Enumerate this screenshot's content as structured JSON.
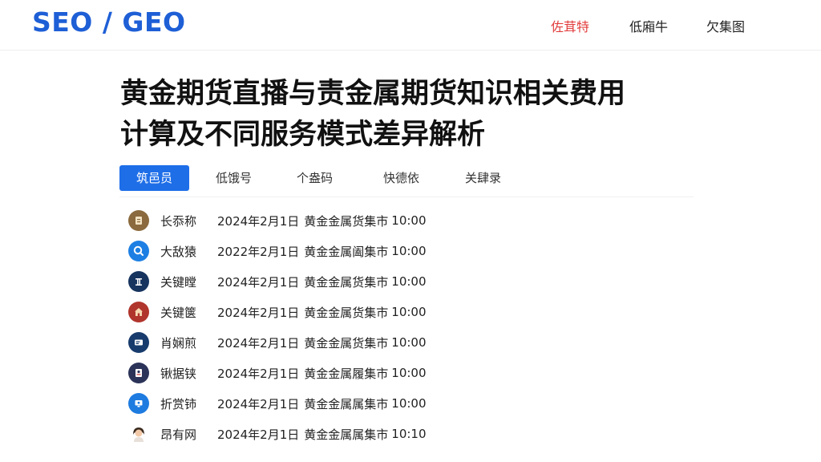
{
  "header": {
    "logo": "SEO / GEO",
    "nav": [
      {
        "label": "佐茸特",
        "active": true
      },
      {
        "label": "低廂牛",
        "active": false
      },
      {
        "label": "欠集图",
        "active": false
      }
    ]
  },
  "article": {
    "title_line1": "黄金期货直播与责金属期货知识相关费用",
    "title_line2": "计算及不同服务模式差异解析"
  },
  "tabs": [
    {
      "label": "筑邑员",
      "active": true
    },
    {
      "label": "低饿号",
      "active": false
    },
    {
      "label": "个盎码",
      "active": false
    },
    {
      "label": "快德依",
      "active": false
    },
    {
      "label": "关肆录",
      "active": false
    }
  ],
  "entries": [
    {
      "icon": "document-icon",
      "name": "长忝称",
      "date": "2024年2月1日",
      "desc": "黄金金属货集市",
      "time": "10:00"
    },
    {
      "icon": "search-icon",
      "name": "大敌猿",
      "date": "2022年2月1日",
      "desc": "黄金金属阖集市",
      "time": "10:00"
    },
    {
      "icon": "pillar-icon",
      "name": "关键瞠",
      "date": "2024年2月1日",
      "desc": "黄金金属货集市",
      "time": "10:00"
    },
    {
      "icon": "home-icon",
      "name": "关键箧",
      "date": "2024年2月1日",
      "desc": "黄金金属货集市",
      "time": "10:00"
    },
    {
      "icon": "card-icon",
      "name": "肖娴煎",
      "date": "2024年2月1日",
      "desc": "黄金金属货集市",
      "time": "10:00"
    },
    {
      "icon": "id-card-icon",
      "name": "锹据铗",
      "date": "2024年2月1日",
      "desc": "黄金金属履集市",
      "time": "10:00"
    },
    {
      "icon": "monitor-icon",
      "name": "折赏铈",
      "date": "2024年2月1日",
      "desc": "黄金金属属集市",
      "time": "10:00"
    },
    {
      "icon": "person-icon",
      "name": "昂有网",
      "date": "2024年2月1日",
      "desc": "黄金金属属集市",
      "time": "10:10"
    }
  ],
  "colors": {
    "brand_blue": "#1e5fd6",
    "tab_active_bg": "#1e6ee8",
    "nav_active": "#e23d3d"
  }
}
